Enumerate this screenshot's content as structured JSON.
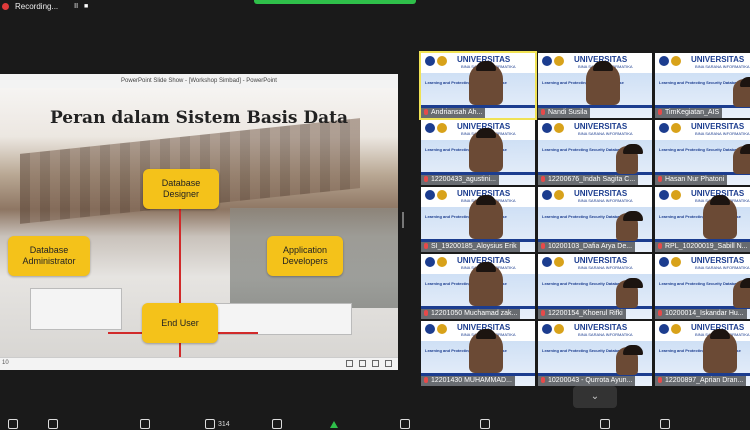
{
  "recording": {
    "label": "Recording...",
    "pause": "II",
    "stop": "■"
  },
  "share": {
    "window_title": "PowerPoint Slide Show - [Workshop Simbad] - PowerPoint",
    "slide_title": "Peran dalam Sistem Basis Data",
    "roles": [
      {
        "name": "Database Designer"
      },
      {
        "name": "Database Administrator"
      },
      {
        "name": "Application Developers"
      },
      {
        "name": "End User"
      }
    ],
    "slide_number": "10"
  },
  "gallery": {
    "banner_title": "UNIVERSITAS",
    "banner_subtitle": "BINA SARANA INFORMATIKA",
    "topic": "Learning and Protecting Security Database",
    "participants": [
      {
        "name": "Andriansah Ah..."
      },
      {
        "name": "Nandi Susila"
      },
      {
        "name": "TimKegiatan_AIS"
      },
      {
        "name": "12200433_agustini..."
      },
      {
        "name": "12200676_Indah Sagita C..."
      },
      {
        "name": "Hasan Nur Phatoni"
      },
      {
        "name": "SI_19200185_Aloysius Erik"
      },
      {
        "name": "10200103_Dafia Arya De..."
      },
      {
        "name": "RPL_10200019_Sabill N..."
      },
      {
        "name": "12201050 Muchamad zak..."
      },
      {
        "name": "12200154_Khoerul Rifki"
      },
      {
        "name": "10200014_Iskandar Hu..."
      },
      {
        "name": "12201430 MUHAMMAD..."
      },
      {
        "name": "10200043 - Qurrota Ayun..."
      },
      {
        "name": "12200897_Aprian Dran..."
      }
    ]
  },
  "toolbar": {
    "participants_count": "314"
  },
  "colors": {
    "accent_green": "#2fbf4a",
    "role_yellow": "#f4c21a",
    "line_red": "#d12a2a"
  }
}
